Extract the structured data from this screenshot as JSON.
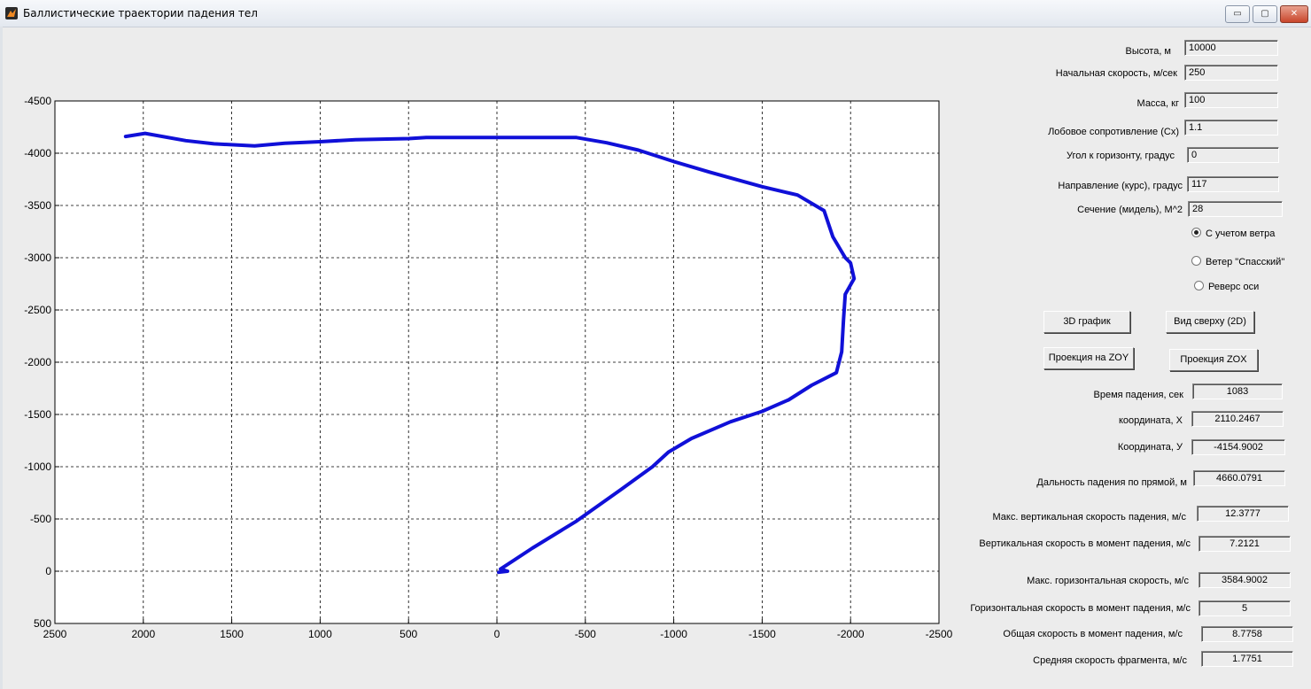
{
  "window": {
    "title": "Баллистические траектории падения тел"
  },
  "inputs": [
    {
      "label": "Высота, м",
      "value": "10000"
    },
    {
      "label": "Начальная скорость, м/сек",
      "value": "250"
    },
    {
      "label": "Масса, кг",
      "value": "100"
    },
    {
      "label": "Лобовое сопротивление (Cx)",
      "value": "1.1"
    },
    {
      "label": "Угол к горизонту, градус",
      "value": "0"
    },
    {
      "label": "Направление  (курс), градус",
      "value": "117"
    },
    {
      "label": "Сечение (мидель), M^2",
      "value": "28"
    }
  ],
  "radios": [
    {
      "label": "С учетом ветра",
      "checked": true
    },
    {
      "label": "Ветер \"Спасский\"",
      "checked": false
    },
    {
      "label": "Реверс оси",
      "checked": false
    }
  ],
  "buttons": {
    "plot3d": "3D график",
    "top_view": "Вид сверху (2D)",
    "proj_zoy": "Проекция на ZOY",
    "proj_zox": "Проекция ZOX"
  },
  "outputs": [
    {
      "label": "Время падения, сек",
      "value": "1083"
    },
    {
      "label": "координата, X",
      "value": "2110.2467"
    },
    {
      "label": "Координата, У",
      "value": "-4154.9002"
    },
    {
      "label": "Дальность падения по прямой, м",
      "value": "4660.0791"
    },
    {
      "label": "Макс.  вертикальная скорость падения, м/с",
      "value": "12.3777"
    },
    {
      "label": "Вертикальная  скорость в момент падения, м/с",
      "value": "7.2121"
    },
    {
      "label": "Макс. горизонтальная скорость, м/с",
      "value": "3584.9002"
    },
    {
      "label": "Горизонтальная скорость в момент падения, м/с",
      "value": "5"
    },
    {
      "label": "Общая скорость в момент падения, м/с",
      "value": "8.7758"
    },
    {
      "label": "Средняя скорость фрагмента, м/с",
      "value": "1.7751"
    }
  ],
  "chart_data": {
    "type": "line",
    "line_color": "#1010d8",
    "grid": true,
    "xlim": [
      2500,
      -2500
    ],
    "ylim": [
      500,
      -4500
    ],
    "xticks": [
      2500,
      2000,
      1500,
      1000,
      500,
      0,
      -500,
      -1000,
      -1500,
      -2000,
      -2500
    ],
    "yticks": [
      -4500,
      -4000,
      -3500,
      -3000,
      -2500,
      -2000,
      -1500,
      -1000,
      -500,
      0,
      500
    ],
    "series": [
      {
        "x": [
          2100,
          1990,
          1760,
          1600,
          1370,
          1200,
          1000,
          800,
          500,
          400,
          200,
          0,
          -200,
          -450,
          -620,
          -800,
          -1000,
          -1200,
          -1500,
          -1700,
          -1850,
          -1900,
          -1970,
          -2000,
          -2020,
          -1970,
          -1960,
          -1950,
          -1920,
          -1780,
          -1650,
          -1500,
          -1320,
          -1100,
          -970,
          -880,
          -700,
          -450,
          -200,
          -20,
          -60,
          -10
        ],
        "y": [
          -4160,
          -4190,
          -4120,
          -4090,
          -4070,
          -4095,
          -4110,
          -4130,
          -4140,
          -4150,
          -4150,
          -4150,
          -4150,
          -4150,
          -4100,
          -4030,
          -3920,
          -3820,
          -3680,
          -3600,
          -3450,
          -3200,
          -3000,
          -2950,
          -2800,
          -2650,
          -2400,
          -2100,
          -1900,
          -1780,
          -1640,
          -1530,
          -1430,
          -1270,
          -1140,
          -1000,
          -780,
          -480,
          -220,
          -20,
          0,
          10
        ]
      }
    ]
  }
}
